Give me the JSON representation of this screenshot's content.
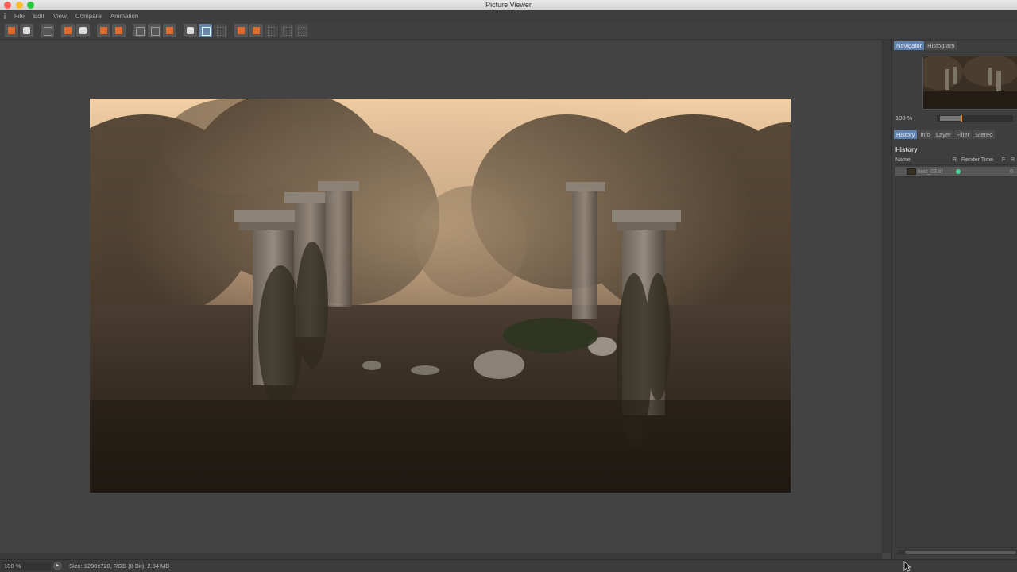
{
  "window": {
    "title": "Picture Viewer"
  },
  "menu": {
    "items": [
      "File",
      "Edit",
      "View",
      "Compare",
      "Animation"
    ]
  },
  "toolbar": {
    "buttons": [
      {
        "icon": "open-folder-icon"
      },
      {
        "icon": "save-icon"
      },
      {
        "icon": "grid-icon"
      },
      {
        "icon": "region-render-icon"
      },
      {
        "icon": "user-stamp-icon"
      },
      {
        "icon": "copy-a-icon"
      },
      {
        "icon": "copy-b-icon"
      },
      {
        "icon": "view-layout-1-icon"
      },
      {
        "icon": "view-layout-2-icon"
      },
      {
        "icon": "view-layout-3-icon"
      },
      {
        "icon": "compare-ab-icon"
      },
      {
        "icon": "compare-split-icon"
      },
      {
        "icon": "compare-off-icon"
      },
      {
        "icon": "set-a-icon"
      },
      {
        "icon": "set-b-icon"
      },
      {
        "icon": "swap-icon"
      },
      {
        "icon": "fit-icon"
      },
      {
        "icon": "zoom-box-icon"
      }
    ]
  },
  "navigator": {
    "tabs": [
      "Navigator",
      "Histogram"
    ],
    "active_tab": "Navigator",
    "zoom_label": "100 %",
    "zoom_slider_fraction": 0.3
  },
  "history_panel": {
    "tabs": [
      "History",
      "Info",
      "Layer",
      "Filter",
      "Stereo"
    ],
    "active_tab": "History",
    "heading": "History",
    "columns": [
      "Name",
      "R",
      "Render Time",
      "F",
      "R"
    ],
    "rows": [
      {
        "name": "test_03.tif",
        "status_color": "#3fd89a",
        "render_time": "",
        "frame": "0"
      }
    ]
  },
  "statusbar": {
    "zoom": "100 %",
    "info": "Size: 1280x720, RGB (8 Bit), 2.84 MB"
  },
  "colors": {
    "accent": "#5f7fae",
    "toolbar_orange": "#e06a2e",
    "zoom_knob": "#e38a1e"
  }
}
